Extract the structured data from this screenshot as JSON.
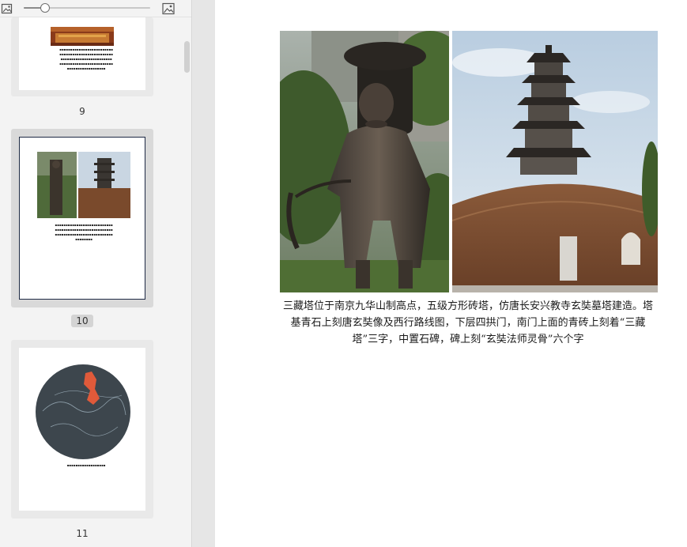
{
  "toolbar": {
    "left_icon": "image-small-icon",
    "right_icon": "image-large-icon",
    "zoom_slider_value": 0.17
  },
  "thumbnails": [
    {
      "page_number": "9",
      "icon": "page-thumbnail",
      "selected": false
    },
    {
      "page_number": "10",
      "icon": "page-thumbnail",
      "selected": true
    },
    {
      "page_number": "11",
      "icon": "page-thumbnail",
      "selected": false
    }
  ],
  "document": {
    "caption": "三藏塔位于南京九华山制高点，五级方形砖塔，仿唐长安兴教寺玄奘墓塔建造。塔基青石上刻唐玄奘像及西行路线图，下层四拱门，南门上面的青砖上刻着“三藏塔”三字，中置石碑，碑上刻“玄奘法师灵骨”六个字"
  },
  "colors": {
    "sidebar_bg": "#f3f3f3",
    "selection_bg": "#d9d9d9",
    "page_bg": "#ffffff",
    "workspace_bg": "#e6e6e6"
  }
}
